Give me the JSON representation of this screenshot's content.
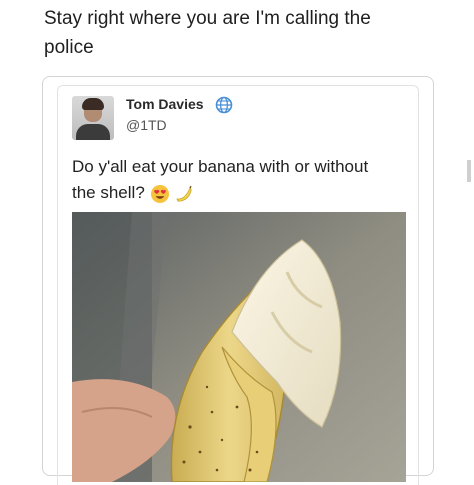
{
  "caption": {
    "line1": "Stay right where you are I'm calling the",
    "line2": "police"
  },
  "tweet": {
    "author_name": "Tom Davies",
    "author_handle": "@1TD",
    "text_line1": "Do y'all eat your banana with or without",
    "text_line2": "the shell?"
  },
  "icons": {
    "globe": "globe-icon",
    "heart_eyes": "heart-eyes-emoji",
    "banana": "banana-emoji"
  },
  "colors": {
    "text": "#1f1f1f",
    "border": "#d4d4d4",
    "banana_peel": "#e6cf7a",
    "banana_flesh": "#f3ecd6"
  }
}
